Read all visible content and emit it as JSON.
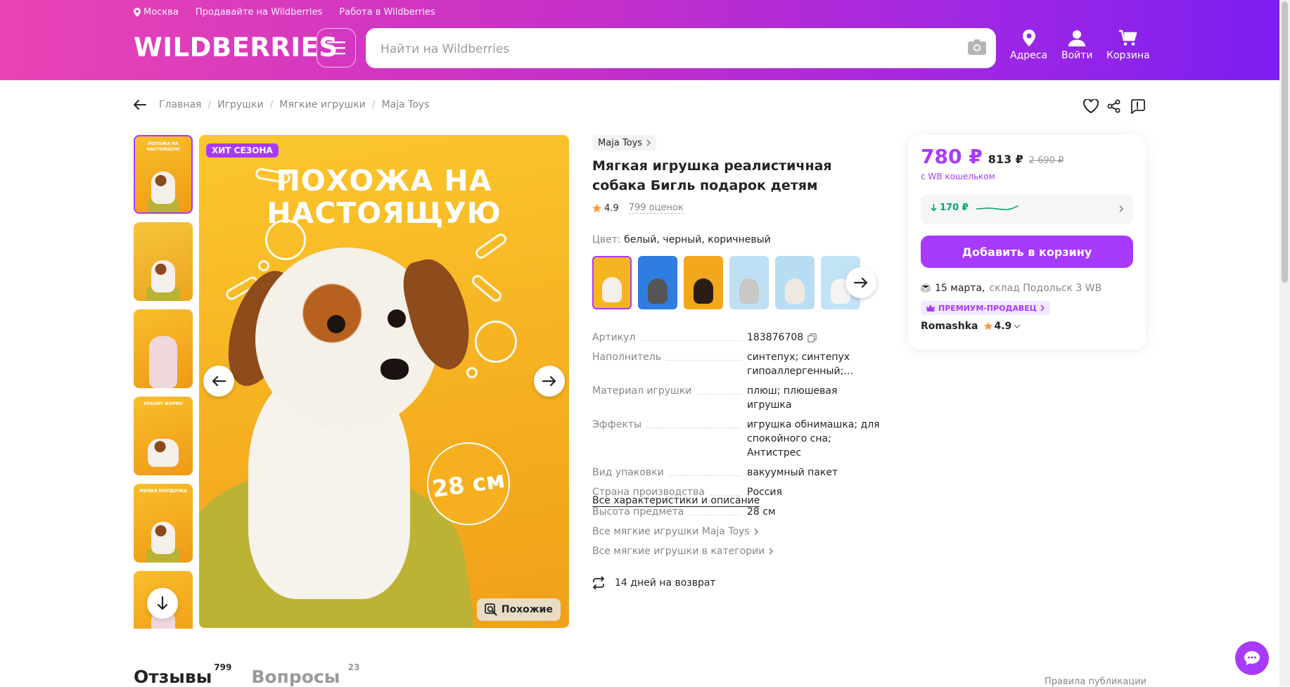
{
  "header": {
    "location": "Москва",
    "links": [
      "Продавайте на Wildberries",
      "Работа в Wildberries"
    ],
    "logo": "WILDBERRIES",
    "search_placeholder": "Найти на Wildberries",
    "nav": [
      "Адреса",
      "Войти",
      "Корзина"
    ]
  },
  "breadcrumbs": [
    "Главная",
    "Игрушки",
    "Мягкие игрушки",
    "Maja Toys"
  ],
  "gallery": {
    "badge": "ХИТ СЕЗОНА",
    "headline": [
      "ПОХОЖА НА",
      "НАСТОЯЩУЮ"
    ],
    "size_label": "28 см",
    "similar_label": "Похожие",
    "thumb_captions": [
      "ПОХОЖА НА НАСТОЯЩУЮ",
      "",
      "",
      "ХРАНИТ ФОРМУ",
      "МИЛАЯ МОРДОЧКА",
      ""
    ]
  },
  "product": {
    "brand": "Maja Toys",
    "title": "Мягкая игрушка реалистичная собака Бигль подарок детям",
    "rating": "4.9",
    "reviews": "799 оценок",
    "color_label": "Цвет:",
    "color_value": "белый, черный, коричневый",
    "specs": [
      {
        "k": "Артикул",
        "v": "183876708"
      },
      {
        "k": "Наполнитель",
        "v": "синтепух; синтепух гипоаллергенный; мягкий наполнитель"
      },
      {
        "k": "Материал игрушки",
        "v": "плюш; плюшевая игрушка"
      },
      {
        "k": "Эффекты",
        "v": "игрушка обнимашка; для спокойного сна; Антистрес"
      },
      {
        "k": "Вид упаковки",
        "v": "вакуумный пакет"
      },
      {
        "k": "Страна производства",
        "v": "Россия"
      },
      {
        "k": "Высота предмета",
        "v": "28 см"
      }
    ],
    "all_specs_link": "Все характеристики и описание",
    "brand_link": "Все мягкие игрушки Maja Toys",
    "category_link": "Все мягкие игрушки в категории",
    "returns": "14 дней на возврат"
  },
  "card": {
    "price": "780 ₽",
    "price_regular": "813 ₽",
    "price_old": "2 690 ₽",
    "wallet_note": "с WB кошельком",
    "price_drop": "170 ₽",
    "add_to_cart": "Добавить в корзину",
    "delivery_date": "15 марта,",
    "delivery_warehouse": "склад Подольск 3 WB",
    "premium": "ПРЕМИУМ-ПРОДАВЕЦ",
    "seller": "Romashka",
    "seller_rating": "4.9"
  },
  "tabs": [
    {
      "label": "Отзывы",
      "count": "799"
    },
    {
      "label": "Вопросы",
      "count": "23"
    }
  ],
  "rules_link": "Правила публикации",
  "colors": {
    "accent": "#a73afd",
    "green": "#03a66d"
  }
}
